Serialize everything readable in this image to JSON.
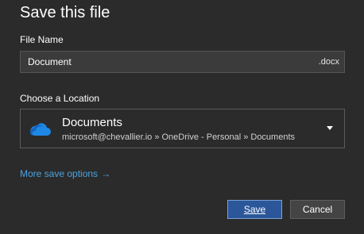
{
  "dialog": {
    "title": "Save this file"
  },
  "file_name": {
    "label": "File Name",
    "value": "Document",
    "extension": ".docx"
  },
  "location": {
    "label": "Choose a Location",
    "name": "Documents",
    "path": "microsoft@chevallier.io » OneDrive - Personal » Documents",
    "icon": "onedrive-cloud-icon"
  },
  "more_options": {
    "label": "More save options",
    "arrow": "→"
  },
  "buttons": {
    "save": "Save",
    "cancel": "Cancel"
  },
  "colors": {
    "background": "#2b2b2b",
    "accent_link": "#4aa3e0",
    "primary_button": "#2b579a",
    "onedrive_blue": "#1e88e5"
  }
}
